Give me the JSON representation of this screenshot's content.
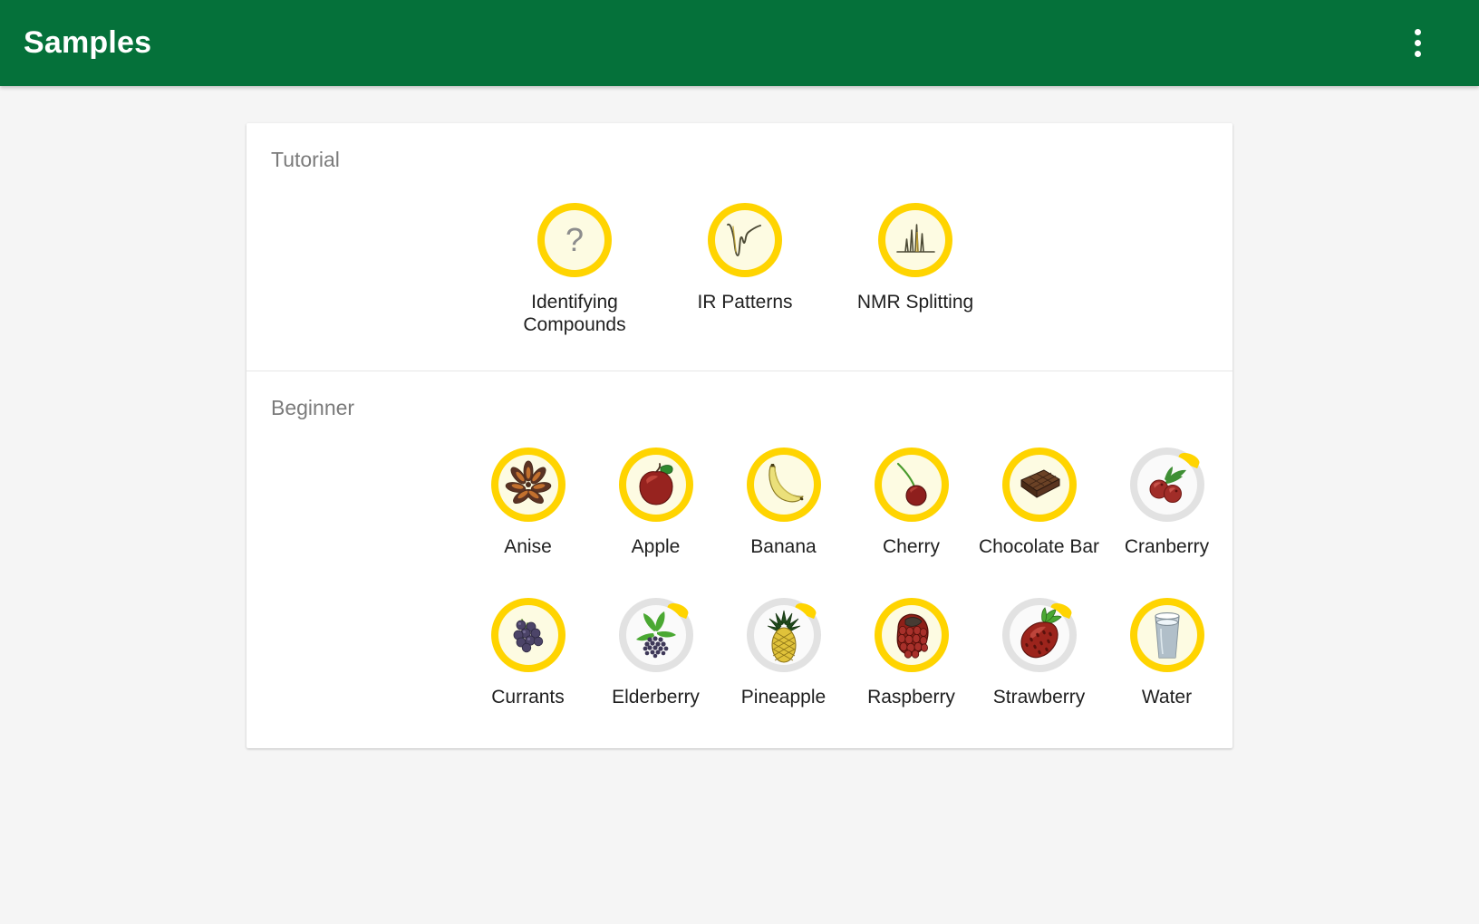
{
  "app": {
    "title": "Samples",
    "accent_color": "#05713a",
    "ring_color": "#ffd400",
    "ring_incomplete_color": "#e2e2e2",
    "background_color": "#f5f5f5",
    "overflow_menu_icon": "more-vertical-icon"
  },
  "sections": [
    {
      "title": "Tutorial",
      "items": [
        {
          "label": "Identifying Compounds",
          "icon": "question-mark-icon",
          "ring": "full"
        },
        {
          "label": "IR Patterns",
          "icon": "ir-spectrum-icon",
          "ring": "full"
        },
        {
          "label": "NMR Splitting",
          "icon": "nmr-peaks-icon",
          "ring": "full"
        }
      ]
    },
    {
      "title": "Beginner",
      "items": [
        {
          "label": "Anise",
          "icon": "star-anise-icon",
          "ring": "full"
        },
        {
          "label": "Apple",
          "icon": "apple-icon",
          "ring": "full"
        },
        {
          "label": "Banana",
          "icon": "banana-icon",
          "ring": "full"
        },
        {
          "label": "Cherry",
          "icon": "cherry-icon",
          "ring": "full"
        },
        {
          "label": "Chocolate Bar",
          "icon": "chocolate-bar-icon",
          "ring": "full"
        },
        {
          "label": "Cranberry",
          "icon": "cranberry-icon",
          "ring": "partial"
        },
        {
          "label": "Currants",
          "icon": "currants-icon",
          "ring": "full"
        },
        {
          "label": "Elderberry",
          "icon": "elderberry-icon",
          "ring": "partial"
        },
        {
          "label": "Pineapple",
          "icon": "pineapple-icon",
          "ring": "partial"
        },
        {
          "label": "Raspberry",
          "icon": "raspberry-icon",
          "ring": "full"
        },
        {
          "label": "Strawberry",
          "icon": "strawberry-icon",
          "ring": "partial"
        },
        {
          "label": "Water",
          "icon": "glass-of-water-icon",
          "ring": "full"
        }
      ]
    }
  ]
}
